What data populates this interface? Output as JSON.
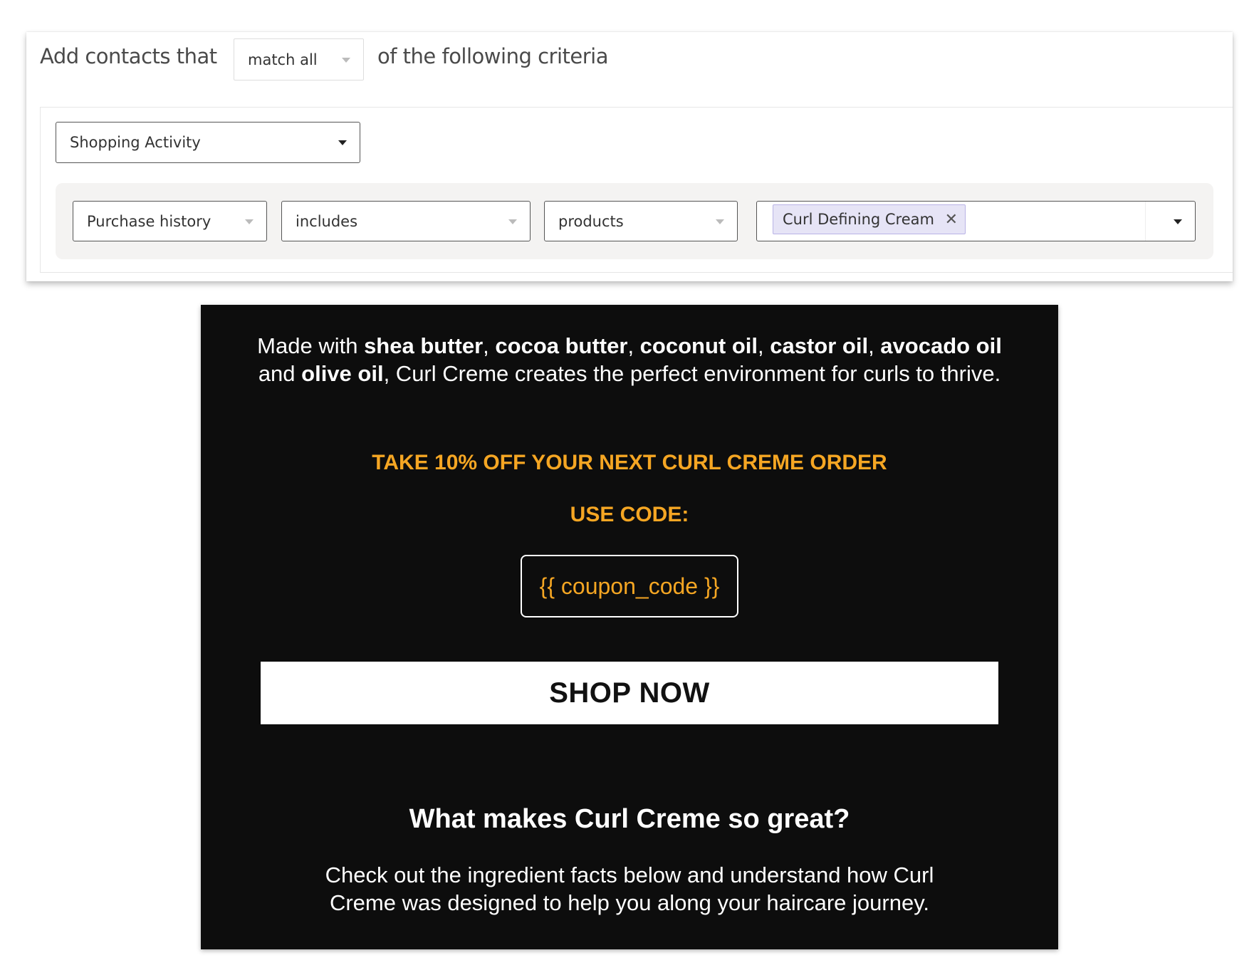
{
  "segment": {
    "title_prefix": "Add contacts that",
    "match_select": "match all",
    "title_suffix": "of the following criteria",
    "category_select": "Shopping Activity",
    "condition": {
      "field": "Purchase history",
      "operator": "includes",
      "type": "products",
      "selected_tags": [
        "Curl Defining Cream"
      ]
    }
  },
  "email": {
    "intro": {
      "t1": "Made with ",
      "b1": "shea butter",
      "t2": ", ",
      "b2": "cocoa butter",
      "t3": ", ",
      "b3": "coconut oil",
      "t4": ", ",
      "b4": "castor oil",
      "t5": ", ",
      "b5": "avocado oil",
      "t6": " and ",
      "b6": "olive oil",
      "t7": ", Curl Creme creates the perfect environment for curls to thrive."
    },
    "offer": "TAKE 10% OFF YOUR NEXT CURL CREME ORDER",
    "use_code": "USE CODE:",
    "coupon": "{{ coupon_code }}",
    "cta": "SHOP NOW",
    "heading": "What makes Curl Creme so great?",
    "body": "Check out the ingredient facts below and understand how Curl Creme was designed to help you along your haircare journey."
  },
  "colors": {
    "accent": "#f5a623",
    "tag_bg": "#e6e4f6",
    "email_bg": "#0d0d0d"
  }
}
